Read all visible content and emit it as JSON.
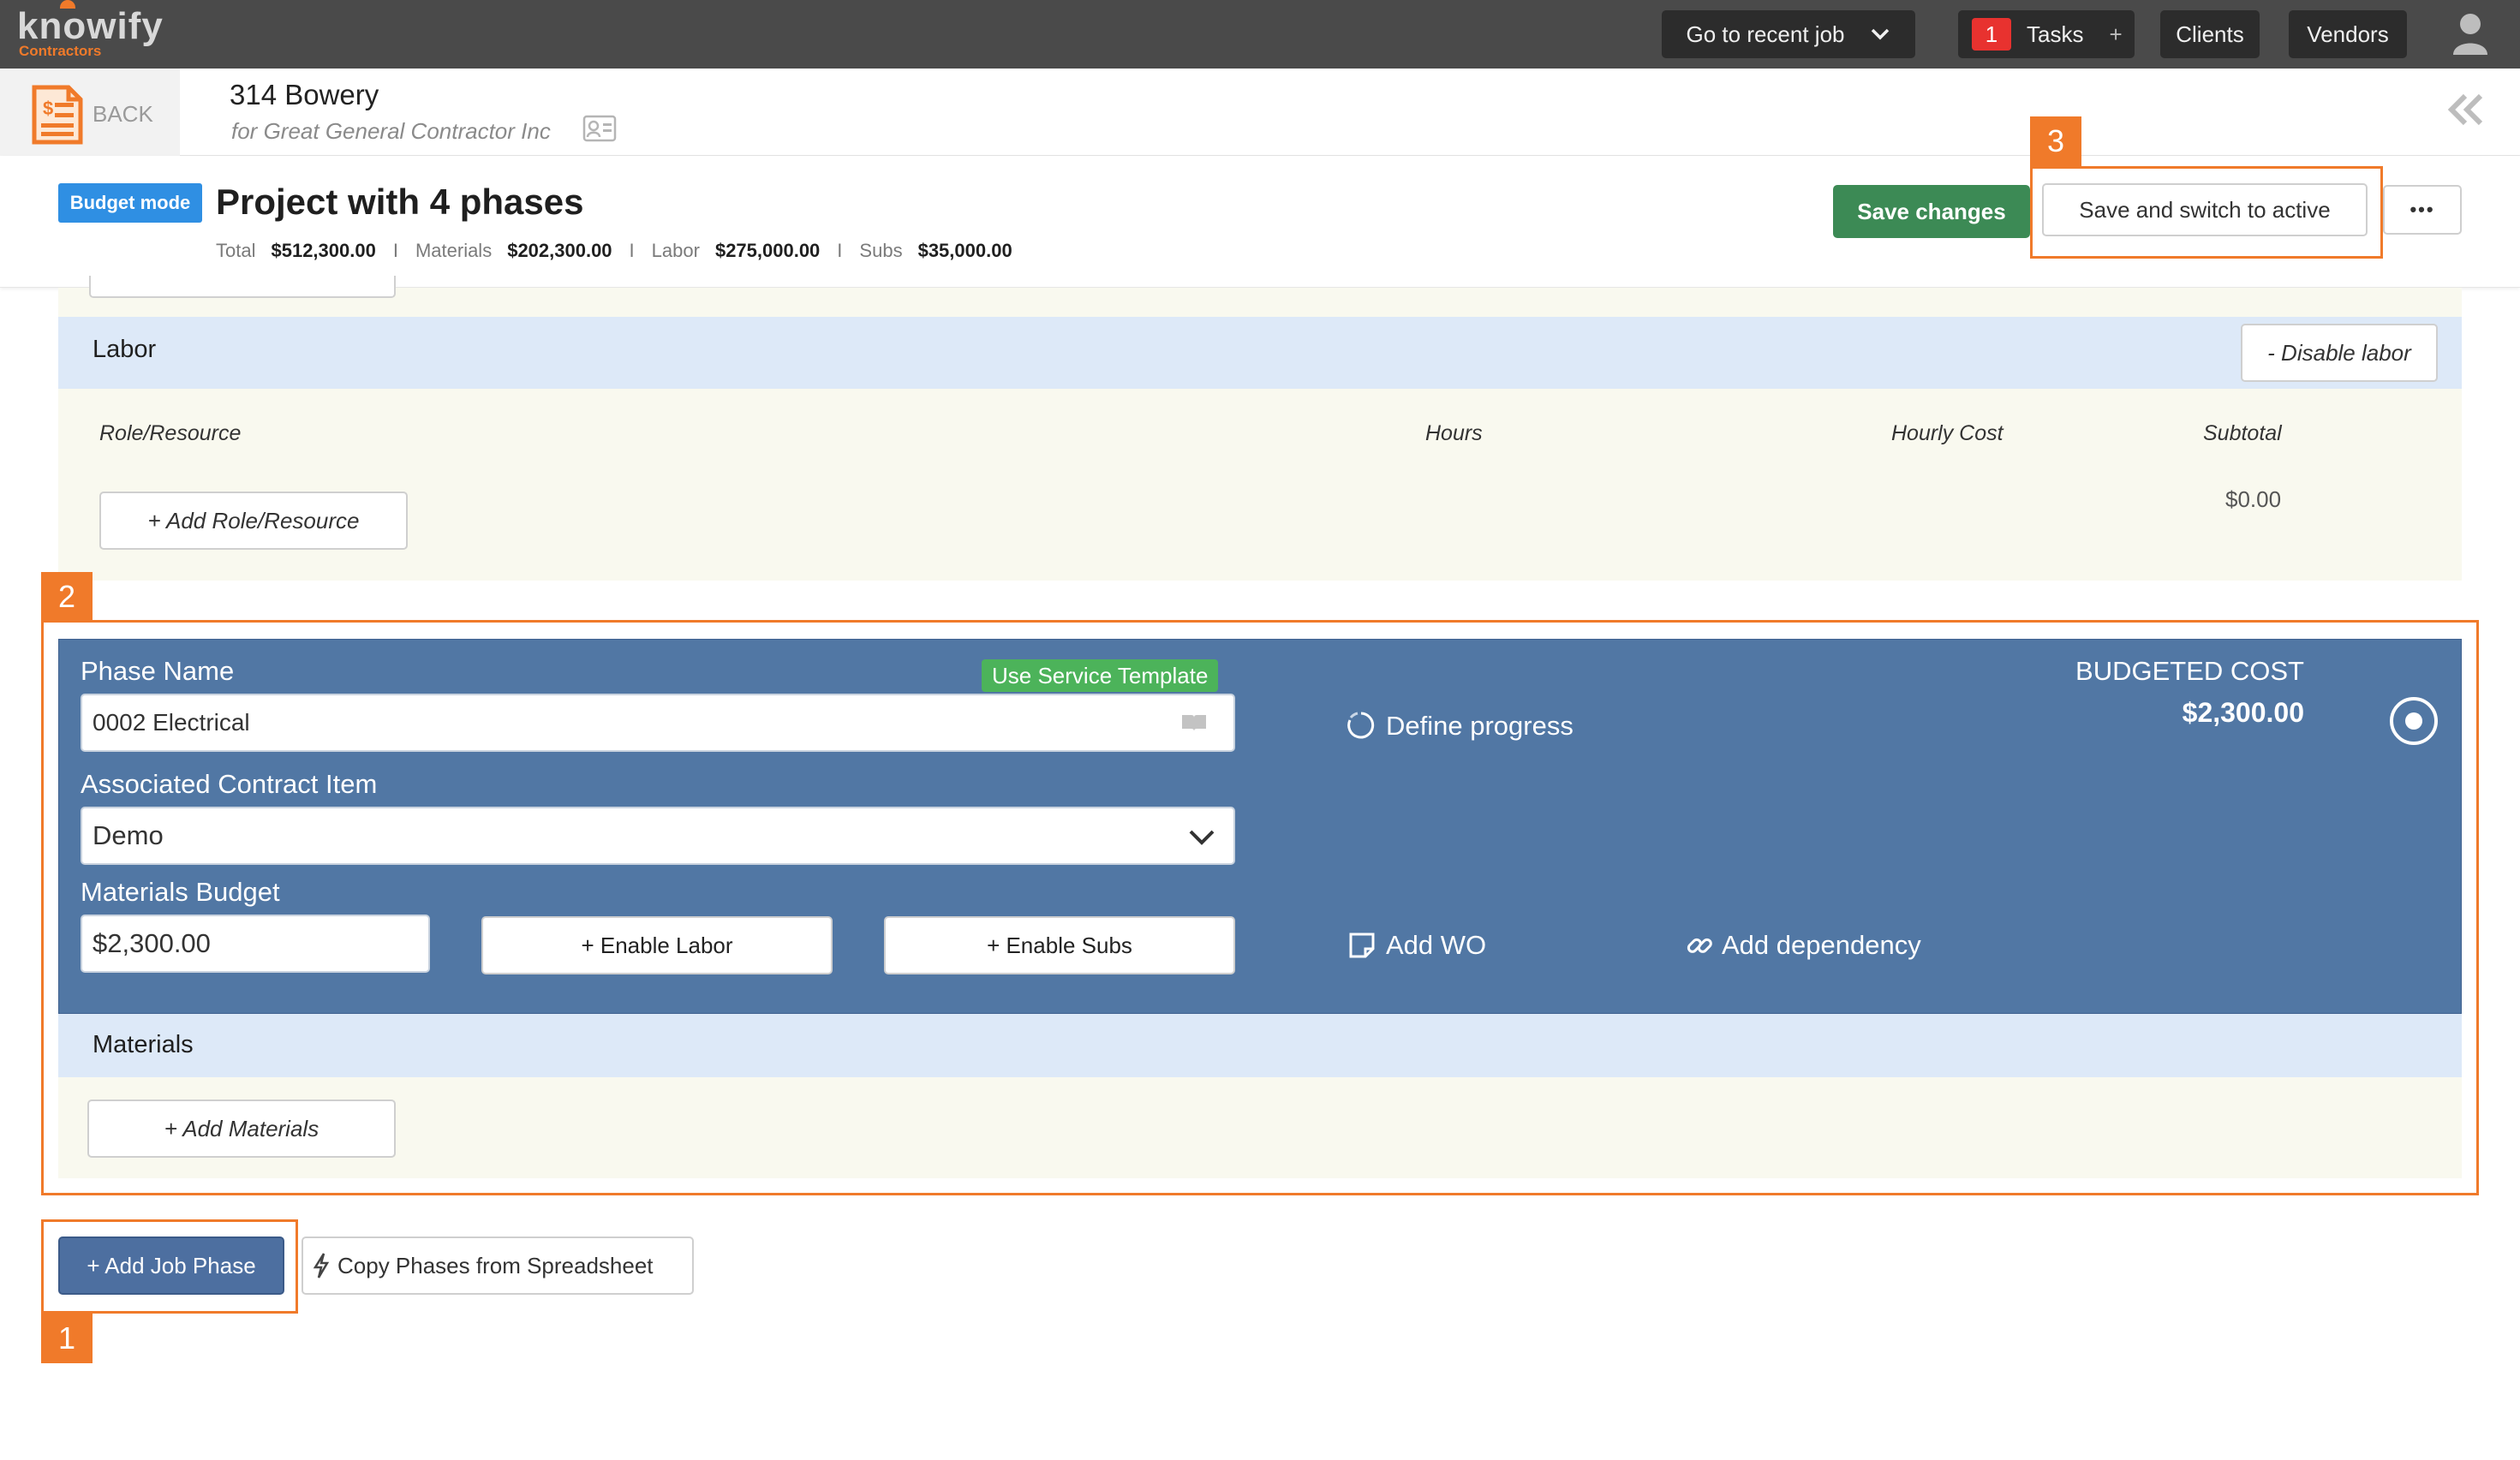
{
  "brand": {
    "logo": "knowify",
    "sub": "Contractors"
  },
  "topnav": {
    "recent_job": "Go to recent job",
    "tasks_count": "1",
    "tasks": "Tasks",
    "tasks_plus": "+",
    "clients": "Clients",
    "vendors": "Vendors"
  },
  "header": {
    "back": "BACK",
    "job_name": "314 Bowery",
    "client": "for Great General Contractor Inc"
  },
  "project": {
    "mode_badge": "Budget mode",
    "title": "Project with 4 phases",
    "totals": {
      "total_label": "Total",
      "total": "$512,300.00",
      "sep": "I",
      "materials_label": "Materials",
      "materials": "$202,300.00",
      "labor_label": "Labor",
      "labor": "$275,000.00",
      "subs_label": "Subs",
      "subs": "$35,000.00"
    },
    "save_changes": "Save changes",
    "save_switch": "Save and switch to active",
    "more": "•••"
  },
  "labor": {
    "heading": "Labor",
    "disable": "- Disable labor",
    "columns": [
      "Role/Resource",
      "Hours",
      "Hourly Cost",
      "Subtotal"
    ],
    "add_role": "+ Add Role/Resource",
    "subtotal": "$0.00"
  },
  "phase": {
    "name_label": "Phase Name",
    "template_badge": "Use Service Template",
    "name_value": "0002 Electrical",
    "contract_label": "Associated Contract Item",
    "contract_value": "Demo",
    "materials_label": "Materials Budget",
    "materials_value": "$2,300.00",
    "enable_labor": "+ Enable Labor",
    "enable_subs": "+ Enable Subs",
    "define_progress": "Define progress",
    "add_wo": "Add WO",
    "add_dependency": "Add dependency",
    "budgeted_label": "BUDGETED COST",
    "budgeted_value": "$2,300.00"
  },
  "materials": {
    "heading": "Materials",
    "add": "+ Add Materials"
  },
  "footer": {
    "add_phase": "+ Add Job Phase",
    "copy_phases": "Copy Phases from Spreadsheet"
  },
  "annotations": [
    "1",
    "2",
    "3"
  ],
  "colors": {
    "brand_orange": "#f07a2a",
    "save_green": "#3c8a55",
    "phase_blue": "#5177a4",
    "badge_blue": "#2f8fe3",
    "template_green": "#4cb35a"
  }
}
